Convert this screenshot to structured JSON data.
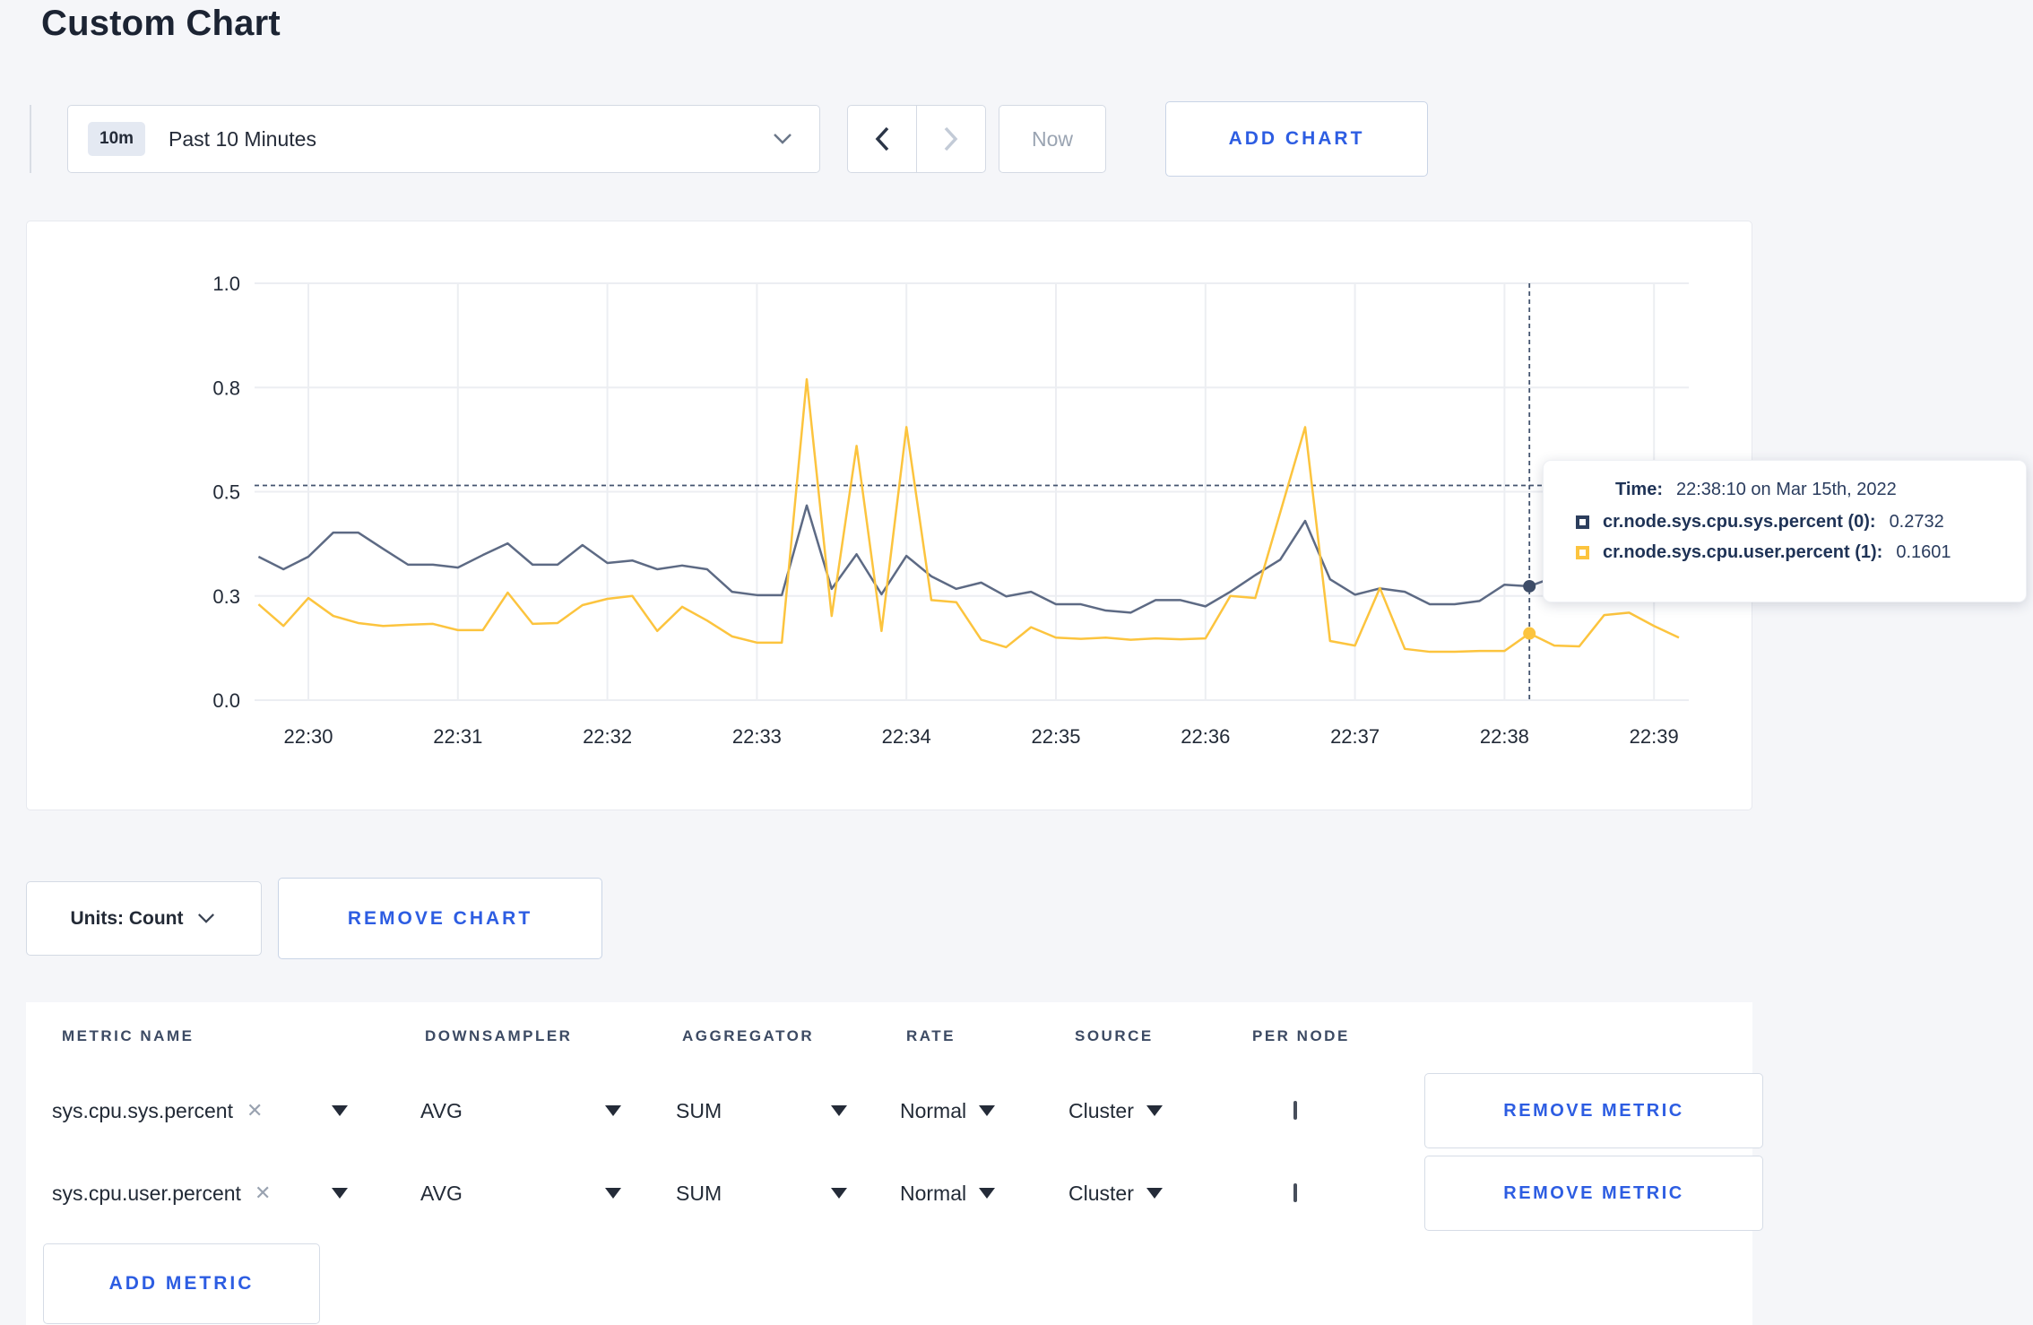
{
  "page": {
    "title": "Custom Chart"
  },
  "toolbar": {
    "range_badge": "10m",
    "range_label": "Past 10 Minutes",
    "now_label": "Now",
    "add_chart_label": "ADD CHART"
  },
  "icons": {
    "clear_glyph": "✕"
  },
  "chart_controls": {
    "units_label": "Units: Count",
    "remove_chart_label": "REMOVE CHART"
  },
  "chart_data": {
    "type": "line",
    "title": "",
    "xlabel": "",
    "ylabel": "",
    "grid": true,
    "legend_position": "none",
    "ylim": [
      0,
      1.0
    ],
    "y_ticks": [
      "1.0",
      "0.8",
      "0.5",
      "0.3",
      "0.0"
    ],
    "x_ticks": [
      "22:30",
      "22:31",
      "22:32",
      "22:33",
      "22:34",
      "22:35",
      "22:36",
      "22:37",
      "22:38",
      "22:39"
    ],
    "x_start": "22:29:40",
    "interval_seconds": 10,
    "crosshair": {
      "index": 51,
      "time": "22:38:10",
      "y_value_hint": 0.515
    },
    "series": [
      {
        "name": "cr.node.sys.cpu.sys.percent",
        "color": "#5d6a84",
        "dot_color": "#3e4d68",
        "values": [
          0.344,
          0.314,
          0.344,
          0.402,
          0.402,
          0.363,
          0.325,
          0.325,
          0.318,
          0.348,
          0.376,
          0.325,
          0.325,
          0.372,
          0.329,
          0.335,
          0.314,
          0.323,
          0.314,
          0.26,
          0.252,
          0.252,
          0.467,
          0.267,
          0.35,
          0.254,
          0.346,
          0.297,
          0.267,
          0.282,
          0.249,
          0.26,
          0.23,
          0.23,
          0.215,
          0.21,
          0.24,
          0.24,
          0.225,
          0.26,
          0.3,
          0.337,
          0.43,
          0.29,
          0.253,
          0.268,
          0.26,
          0.23,
          0.23,
          0.238,
          0.277,
          0.2732,
          0.295,
          0.3,
          0.298,
          0.3,
          0.302,
          0.305
        ]
      },
      {
        "name": "cr.node.sys.cpu.user.percent",
        "color": "#fcc43e",
        "dot_color": "#fcc43e",
        "values": [
          0.23,
          0.178,
          0.245,
          0.202,
          0.185,
          0.178,
          0.181,
          0.183,
          0.168,
          0.168,
          0.258,
          0.183,
          0.185,
          0.228,
          0.243,
          0.25,
          0.166,
          0.224,
          0.191,
          0.153,
          0.138,
          0.138,
          0.77,
          0.202,
          0.61,
          0.166,
          0.655,
          0.24,
          0.235,
          0.145,
          0.127,
          0.175,
          0.15,
          0.147,
          0.15,
          0.145,
          0.148,
          0.146,
          0.148,
          0.25,
          0.245,
          0.45,
          0.655,
          0.142,
          0.131,
          0.269,
          0.123,
          0.116,
          0.116,
          0.118,
          0.118,
          0.1601,
          0.131,
          0.129,
          0.204,
          0.21,
          0.178,
          0.15
        ]
      }
    ]
  },
  "tooltip": {
    "time_label": "Time:",
    "time_value": "22:38:10 on Mar 15th, 2022",
    "rows": [
      {
        "label": "cr.node.sys.cpu.sys.percent (0):",
        "value": "0.2732",
        "swatch_color": "#2c3e5d"
      },
      {
        "label": "cr.node.sys.cpu.user.percent (1):",
        "value": "0.1601",
        "swatch_color": "#fcc43e"
      }
    ]
  },
  "metrics_table": {
    "headers": {
      "metric_name": "METRIC NAME",
      "downsampler": "DOWNSAMPLER",
      "aggregator": "AGGREGATOR",
      "rate": "RATE",
      "source": "SOURCE",
      "per_node": "PER NODE"
    },
    "rows": [
      {
        "metric": "sys.cpu.sys.percent",
        "downsampler": "AVG",
        "aggregator": "SUM",
        "rate": "Normal",
        "source": "Cluster",
        "per_node_checked": false,
        "remove_label": "REMOVE METRIC"
      },
      {
        "metric": "sys.cpu.user.percent",
        "downsampler": "AVG",
        "aggregator": "SUM",
        "rate": "Normal",
        "source": "Cluster",
        "per_node_checked": false,
        "remove_label": "REMOVE METRIC"
      }
    ],
    "add_metric_label": "ADD METRIC"
  }
}
